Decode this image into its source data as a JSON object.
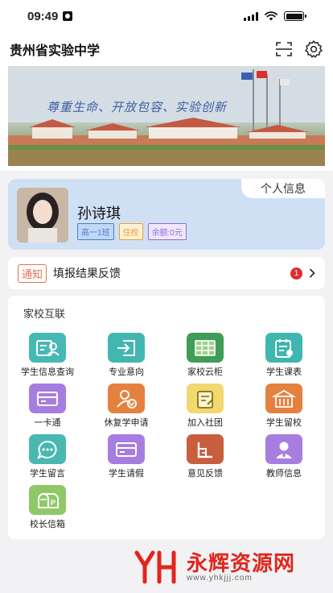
{
  "status": {
    "time": "09:49"
  },
  "nav": {
    "title": "贵州省实验中学"
  },
  "banner": {
    "slogan": "尊重生命、开放包容、实验创新"
  },
  "profile": {
    "tab_label": "个人信息",
    "name": "孙诗琪",
    "tags": [
      {
        "text": "高一1班",
        "color": "#4a7fd1"
      },
      {
        "text": "住校",
        "color": "#e8a032"
      },
      {
        "text": "余额:0元",
        "color": "#8f6cd8"
      }
    ]
  },
  "notice": {
    "badge": "通知",
    "text": "填报结果反馈",
    "count": "1"
  },
  "section": {
    "title": "家校互联",
    "items": [
      {
        "label": "学生信息查询",
        "icon": "id-card-icon",
        "color": "#46b9b4"
      },
      {
        "label": "专业意向",
        "icon": "login-arrow-icon",
        "color": "#43b6b2"
      },
      {
        "label": "家校云柜",
        "icon": "cabinet-icon",
        "color": "#3f9d57"
      },
      {
        "label": "学生课表",
        "icon": "schedule-icon",
        "color": "#3fb6af"
      },
      {
        "label": "一卡通",
        "icon": "card-icon",
        "color": "#a77de0"
      },
      {
        "label": "休复学申请",
        "icon": "user-check-icon",
        "color": "#e5813f"
      },
      {
        "label": "加入社团",
        "icon": "club-icon",
        "color": "#f1d86f"
      },
      {
        "label": "学生留校",
        "icon": "building-icon",
        "color": "#e5813f"
      },
      {
        "label": "学生留言",
        "icon": "chat-icon",
        "color": "#49b8b1"
      },
      {
        "label": "学生请假",
        "icon": "leave-card-icon",
        "color": "#a77de0"
      },
      {
        "label": "意见反馈",
        "icon": "feedback-icon",
        "color": "#c85e3e"
      },
      {
        "label": "教师信息",
        "icon": "teacher-icon",
        "color": "#a77de0"
      },
      {
        "label": "校长信箱",
        "icon": "mailbox-icon",
        "color": "#8fc866"
      }
    ]
  },
  "watermark": {
    "brand": "永辉资源网",
    "url": "www.yhkjjj.com"
  }
}
